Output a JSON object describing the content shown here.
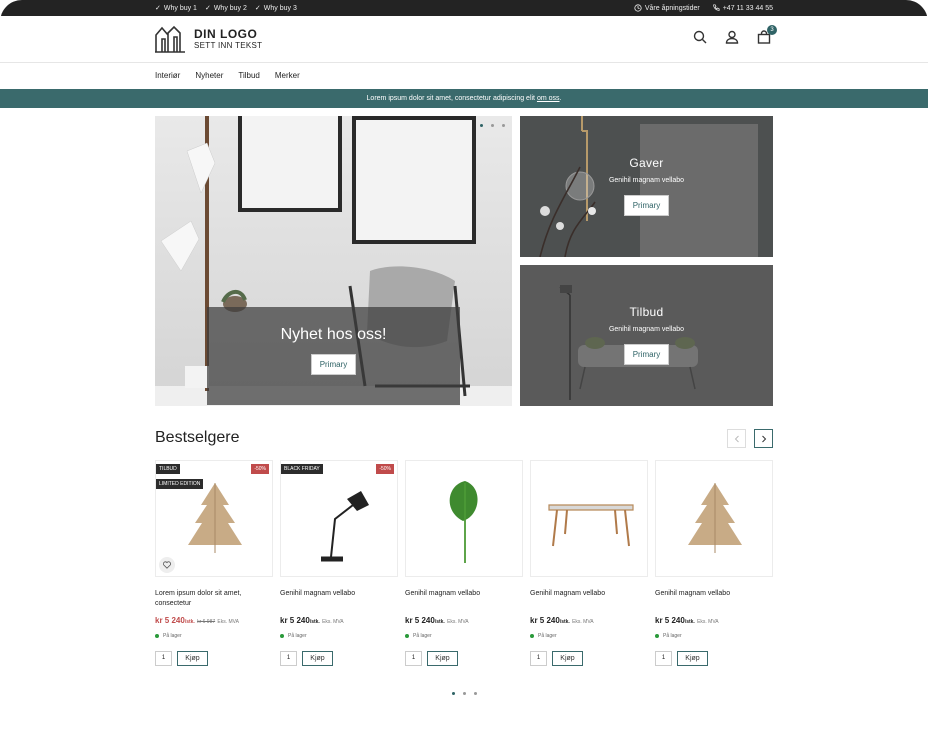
{
  "topbar": {
    "usps": [
      "Why buy 1",
      "Why buy 2",
      "Why buy 3"
    ],
    "opening_hours": "Våre åpningstider",
    "phone": "+47 11 33 44 55"
  },
  "header": {
    "logo_title": "DIN LOGO",
    "logo_subtitle": "SETT INN TEKST",
    "cart_count": "3"
  },
  "nav": {
    "items": [
      "Interiør",
      "Nyheter",
      "Tilbud",
      "Merker"
    ]
  },
  "notice": {
    "text": "Lorem ipsum dolor sit amet, consectetur adipiscing elit",
    "link": "om oss",
    "suffix": "."
  },
  "hero": {
    "title": "Nyhet hos oss!",
    "button": "Primary"
  },
  "tiles": [
    {
      "title": "Gaver",
      "subtitle": "Genihil magnam vellabo",
      "button": "Primary"
    },
    {
      "title": "Tilbud",
      "subtitle": "Genihil magnam vellabo",
      "button": "Primary"
    }
  ],
  "bestsellers": {
    "title": "Bestselgere",
    "products": [
      {
        "tags": [
          "TILBUD",
          "LIMITED EDITION"
        ],
        "sale": "-50%",
        "name": "Lorem ipsum dolor sit amet, consectetur",
        "price": "kr 5 240",
        "unit": "/stk.",
        "old_price": "kr 6 987",
        "vat": "Eks. MVA",
        "stock": "På lager",
        "qty": "1",
        "buy": "Kjøp",
        "image": "tree"
      },
      {
        "tags": [
          "BLACK FRIDAY"
        ],
        "sale": "-50%",
        "name": "Genihil magnam vellabo",
        "price": "kr 5 240",
        "unit": "/stk.",
        "old_price": "",
        "vat": "Eks. MVA",
        "stock": "På lager",
        "qty": "1",
        "buy": "Kjøp",
        "image": "lamp"
      },
      {
        "tags": [],
        "sale": "",
        "name": "Genihil magnam vellabo",
        "price": "kr 5 240",
        "unit": "/stk.",
        "old_price": "",
        "vat": "Eks. MVA",
        "stock": "På lager",
        "qty": "1",
        "buy": "Kjøp",
        "image": "leaf"
      },
      {
        "tags": [],
        "sale": "",
        "name": "Genihil magnam vellabo",
        "price": "kr 5 240",
        "unit": "/stk.",
        "old_price": "",
        "vat": "Eks. MVA",
        "stock": "På lager",
        "qty": "1",
        "buy": "Kjøp",
        "image": "table"
      },
      {
        "tags": [],
        "sale": "",
        "name": "Genihil magnam vellabo",
        "price": "kr 5 240",
        "unit": "/stk.",
        "old_price": "",
        "vat": "Eks. MVA",
        "stock": "På lager",
        "qty": "1",
        "buy": "Kjøp",
        "image": "tree"
      }
    ]
  },
  "colors": {
    "brand": "#3a6a6c",
    "sale": "#c04b4b",
    "topbar": "#232323"
  }
}
